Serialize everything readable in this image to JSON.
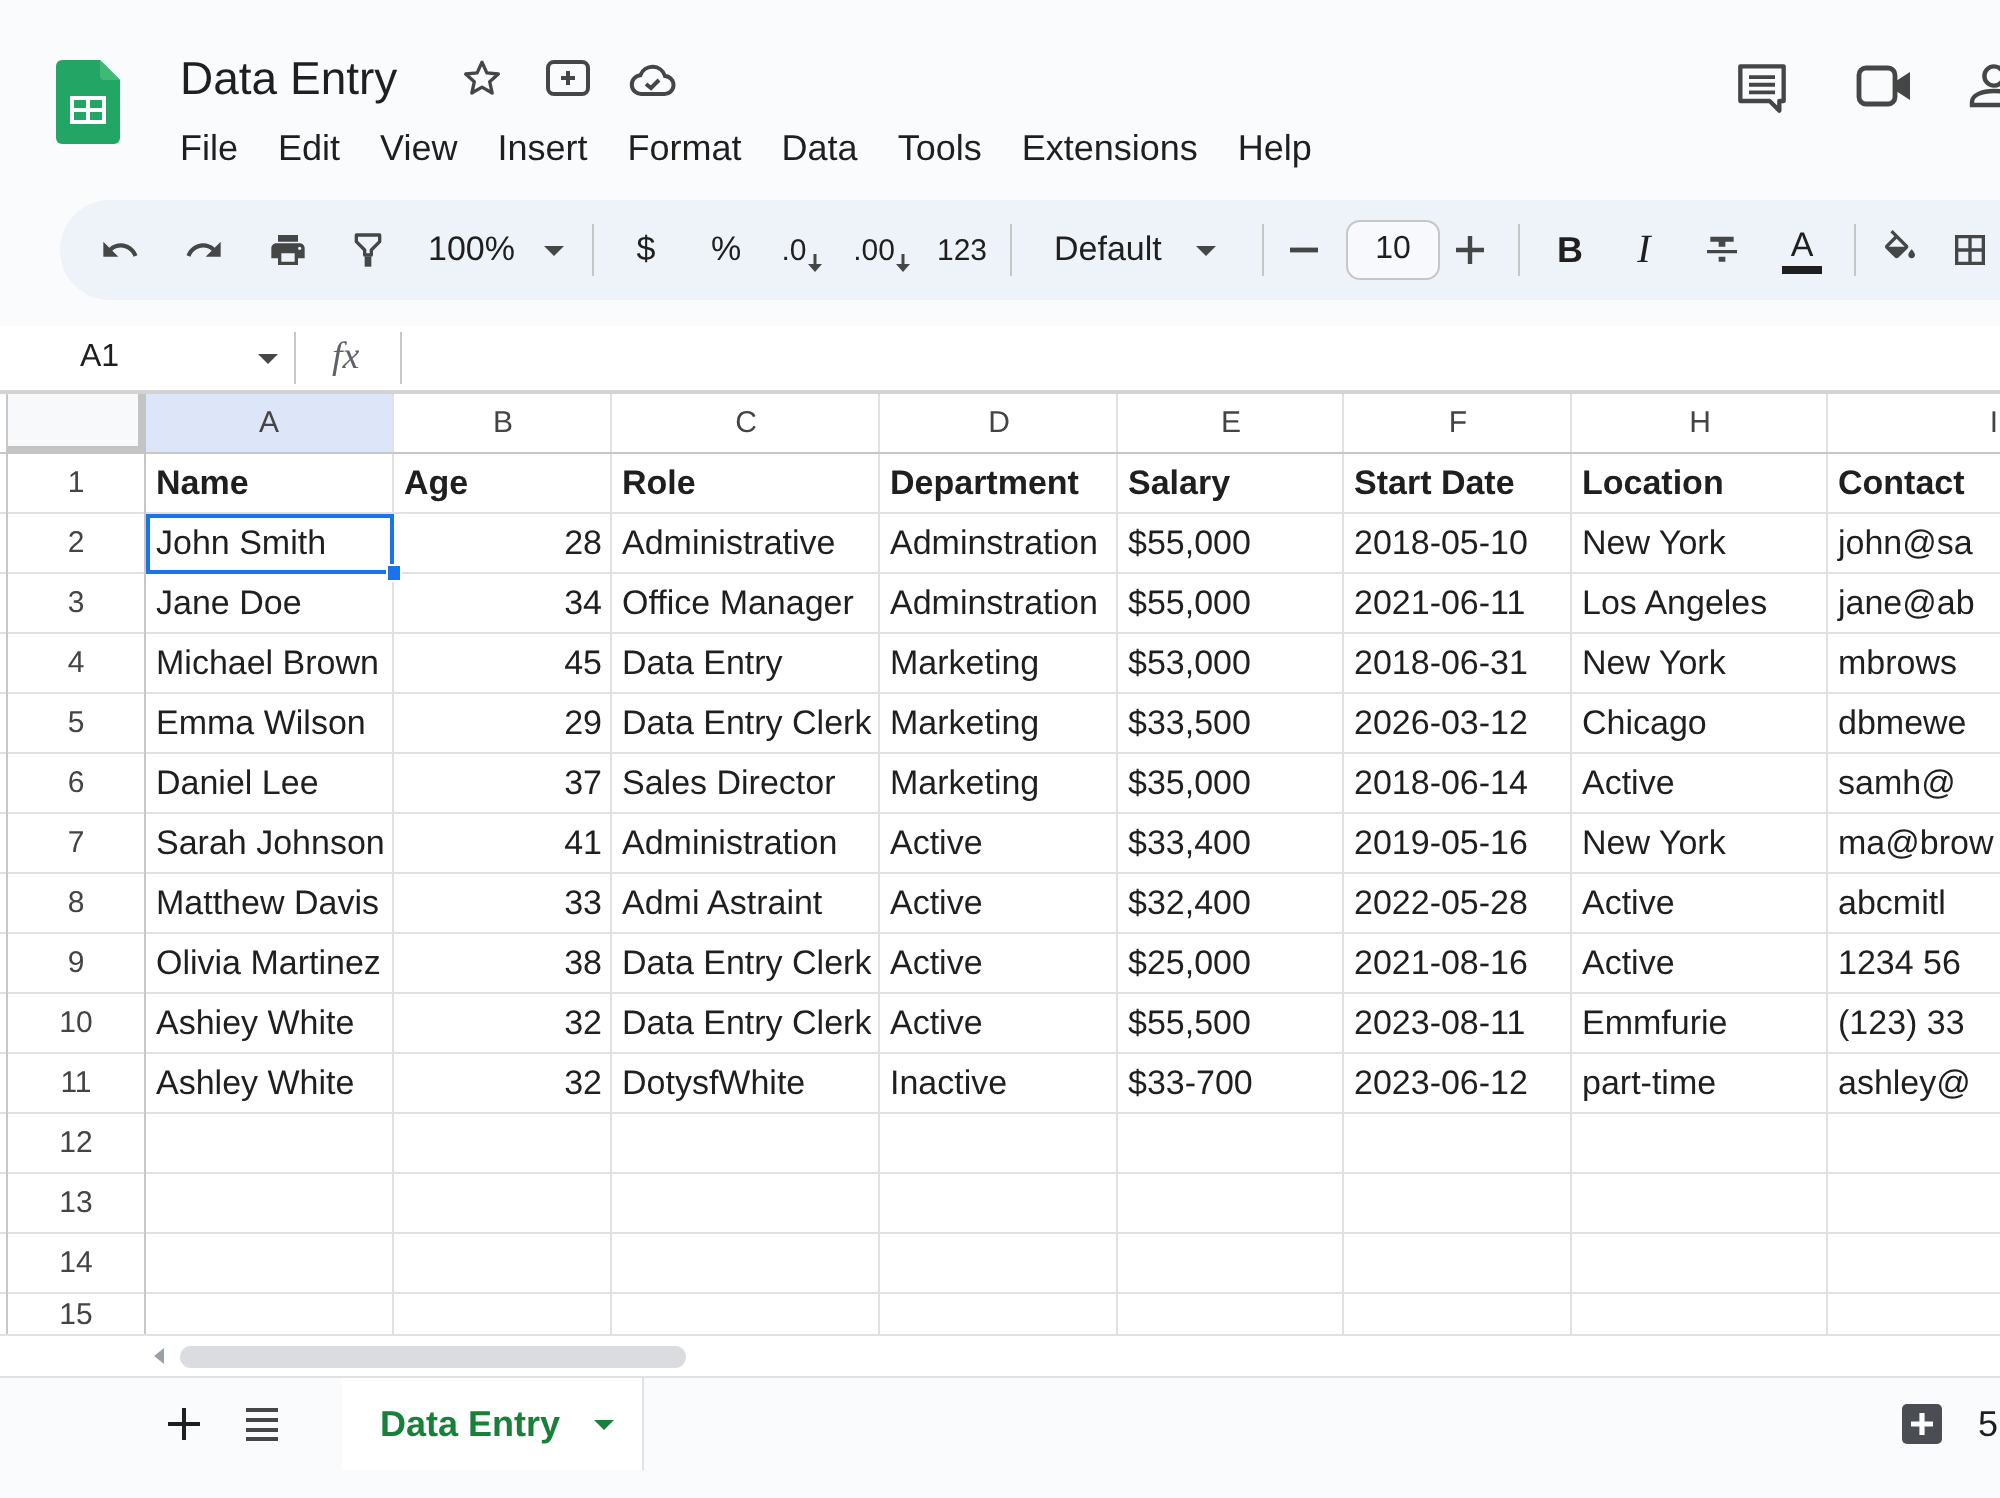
{
  "app": {
    "title": "Data Entry",
    "menu": [
      "File",
      "Edit",
      "View",
      "Insert",
      "Format",
      "Data",
      "Tools",
      "Extensions",
      "Help"
    ]
  },
  "toolbar": {
    "zoom": "100%",
    "currency": "$",
    "percent": "%",
    "decrease_decimal": ".0",
    "increase_decimal": ".00",
    "number_format": "123",
    "font": "Default",
    "font_size": "10",
    "bold": "B",
    "italic": "I",
    "text_color": "A"
  },
  "formula_bar": {
    "cell_ref": "A1",
    "fx": "fx"
  },
  "sheet": {
    "columns": [
      {
        "letter": "A",
        "highlighted": true
      },
      {
        "letter": "B",
        "highlighted": false
      },
      {
        "letter": "C",
        "highlighted": false
      },
      {
        "letter": "D",
        "highlighted": false
      },
      {
        "letter": "E",
        "highlighted": false
      },
      {
        "letter": "F",
        "highlighted": false
      },
      {
        "letter": "H",
        "highlighted": false
      },
      {
        "letter": "I",
        "highlighted": false
      }
    ],
    "rows": [
      {
        "number": "1",
        "kind": "header",
        "cells": [
          {
            "text": "Name",
            "kind": "text",
            "selected": false
          },
          {
            "text": "Age",
            "kind": "text",
            "selected": false
          },
          {
            "text": "Role",
            "kind": "text",
            "selected": false
          },
          {
            "text": "Department",
            "kind": "text",
            "selected": false
          },
          {
            "text": "Salary",
            "kind": "text",
            "selected": false
          },
          {
            "text": "Start Date",
            "kind": "text",
            "selected": false
          },
          {
            "text": "Location",
            "kind": "text",
            "selected": false
          },
          {
            "text": "Contact",
            "kind": "text",
            "selected": false
          }
        ]
      },
      {
        "number": "2",
        "kind": "data",
        "cells": [
          {
            "text": "John Smith",
            "kind": "text",
            "selected": true
          },
          {
            "text": "28",
            "kind": "number",
            "selected": false
          },
          {
            "text": "Administrative",
            "kind": "text",
            "selected": false
          },
          {
            "text": "Adminstration",
            "kind": "text",
            "selected": false
          },
          {
            "text": "$55,000",
            "kind": "text",
            "selected": false
          },
          {
            "text": "2018-05-10",
            "kind": "text",
            "selected": false
          },
          {
            "text": "New York",
            "kind": "text",
            "selected": false
          },
          {
            "text": "john@sa",
            "kind": "text",
            "selected": false
          }
        ]
      },
      {
        "number": "3",
        "kind": "data",
        "cells": [
          {
            "text": "Jane Doe",
            "kind": "text",
            "selected": false
          },
          {
            "text": "34",
            "kind": "number",
            "selected": false
          },
          {
            "text": "Office Manager",
            "kind": "text",
            "selected": false
          },
          {
            "text": "Adminstration",
            "kind": "text",
            "selected": false
          },
          {
            "text": "$55,000",
            "kind": "text",
            "selected": false
          },
          {
            "text": "2021-06-11",
            "kind": "text",
            "selected": false
          },
          {
            "text": "Los Angeles",
            "kind": "text",
            "selected": false
          },
          {
            "text": "jane@ab",
            "kind": "text",
            "selected": false
          }
        ]
      },
      {
        "number": "4",
        "kind": "data",
        "cells": [
          {
            "text": "Michael Brown",
            "kind": "text",
            "selected": false
          },
          {
            "text": "45",
            "kind": "number",
            "selected": false
          },
          {
            "text": "Data Entry",
            "kind": "text",
            "selected": false
          },
          {
            "text": "Marketing",
            "kind": "text",
            "selected": false
          },
          {
            "text": "$53,000",
            "kind": "text",
            "selected": false
          },
          {
            "text": "2018-06-31",
            "kind": "text",
            "selected": false
          },
          {
            "text": "New York",
            "kind": "text",
            "selected": false
          },
          {
            "text": "mbrows",
            "kind": "text",
            "selected": false
          }
        ]
      },
      {
        "number": "5",
        "kind": "data",
        "cells": [
          {
            "text": "Emma Wilson",
            "kind": "text",
            "selected": false
          },
          {
            "text": "29",
            "kind": "number",
            "selected": false
          },
          {
            "text": "Data Entry Clerk",
            "kind": "text",
            "selected": false
          },
          {
            "text": "Marketing",
            "kind": "text",
            "selected": false
          },
          {
            "text": "$33,500",
            "kind": "text",
            "selected": false
          },
          {
            "text": "2026-03-12",
            "kind": "text",
            "selected": false
          },
          {
            "text": "Chicago",
            "kind": "text",
            "selected": false
          },
          {
            "text": "dbmewe",
            "kind": "text",
            "selected": false
          }
        ]
      },
      {
        "number": "6",
        "kind": "data",
        "cells": [
          {
            "text": "Daniel Lee",
            "kind": "text",
            "selected": false
          },
          {
            "text": "37",
            "kind": "number",
            "selected": false
          },
          {
            "text": "Sales Director",
            "kind": "text",
            "selected": false
          },
          {
            "text": "Marketing",
            "kind": "text",
            "selected": false
          },
          {
            "text": "$35,000",
            "kind": "text",
            "selected": false
          },
          {
            "text": "2018-06-14",
            "kind": "text",
            "selected": false
          },
          {
            "text": "Active",
            "kind": "text",
            "selected": false
          },
          {
            "text": "samh@",
            "kind": "text",
            "selected": false
          }
        ]
      },
      {
        "number": "7",
        "kind": "data",
        "cells": [
          {
            "text": "Sarah Johnson",
            "kind": "text",
            "selected": false
          },
          {
            "text": "41",
            "kind": "number",
            "selected": false
          },
          {
            "text": "Administration",
            "kind": "text",
            "selected": false
          },
          {
            "text": "Active",
            "kind": "text",
            "selected": false
          },
          {
            "text": "$33,400",
            "kind": "text",
            "selected": false
          },
          {
            "text": "2019-05-16",
            "kind": "text",
            "selected": false
          },
          {
            "text": "New York",
            "kind": "text",
            "selected": false
          },
          {
            "text": "ma@brow",
            "kind": "text",
            "selected": false
          }
        ]
      },
      {
        "number": "8",
        "kind": "data",
        "cells": [
          {
            "text": "Matthew Davis",
            "kind": "text",
            "selected": false
          },
          {
            "text": "33",
            "kind": "number",
            "selected": false
          },
          {
            "text": "Admi Astraint",
            "kind": "text",
            "selected": false
          },
          {
            "text": "Active",
            "kind": "text",
            "selected": false
          },
          {
            "text": "$32,400",
            "kind": "text",
            "selected": false
          },
          {
            "text": "2022-05-28",
            "kind": "text",
            "selected": false
          },
          {
            "text": "Active",
            "kind": "text",
            "selected": false
          },
          {
            "text": "abcmitl",
            "kind": "text",
            "selected": false
          }
        ]
      },
      {
        "number": "9",
        "kind": "data",
        "cells": [
          {
            "text": "Olivia Martinez",
            "kind": "text",
            "selected": false
          },
          {
            "text": "38",
            "kind": "number",
            "selected": false
          },
          {
            "text": "Data Entry Clerk",
            "kind": "text",
            "selected": false
          },
          {
            "text": "Active",
            "kind": "text",
            "selected": false
          },
          {
            "text": "$25,000",
            "kind": "text",
            "selected": false
          },
          {
            "text": "2021-08-16",
            "kind": "text",
            "selected": false
          },
          {
            "text": "Active",
            "kind": "text",
            "selected": false
          },
          {
            "text": "1234 56",
            "kind": "text",
            "selected": false
          }
        ]
      },
      {
        "number": "10",
        "kind": "data",
        "cells": [
          {
            "text": "Ashiey White",
            "kind": "text",
            "selected": false
          },
          {
            "text": "32",
            "kind": "number",
            "selected": false
          },
          {
            "text": "Data Entry Clerk",
            "kind": "text",
            "selected": false
          },
          {
            "text": "Active",
            "kind": "text",
            "selected": false
          },
          {
            "text": "$55,500",
            "kind": "text",
            "selected": false
          },
          {
            "text": "2023-08-11",
            "kind": "text",
            "selected": false
          },
          {
            "text": "Emmfurie",
            "kind": "text",
            "selected": false
          },
          {
            "text": "(123) 33",
            "kind": "text",
            "selected": false
          }
        ]
      },
      {
        "number": "11",
        "kind": "data",
        "cells": [
          {
            "text": "Ashley White",
            "kind": "text",
            "selected": false
          },
          {
            "text": "32",
            "kind": "number",
            "selected": false
          },
          {
            "text": "DotysfWhite",
            "kind": "text",
            "selected": false
          },
          {
            "text": "Inactive",
            "kind": "text",
            "selected": false
          },
          {
            "text": "$33-700",
            "kind": "text",
            "selected": false
          },
          {
            "text": "2023-06-12",
            "kind": "text",
            "selected": false
          },
          {
            "text": "part-time",
            "kind": "text",
            "selected": false
          },
          {
            "text": "ashley@",
            "kind": "text",
            "selected": false
          }
        ]
      },
      {
        "number": "12",
        "kind": "empty"
      },
      {
        "number": "13",
        "kind": "empty"
      },
      {
        "number": "14",
        "kind": "empty"
      },
      {
        "number": "15",
        "kind": "empty"
      }
    ]
  },
  "sheet_tabs": [
    {
      "label": "Data Entry",
      "selected": true
    }
  ],
  "status_text": "5"
}
